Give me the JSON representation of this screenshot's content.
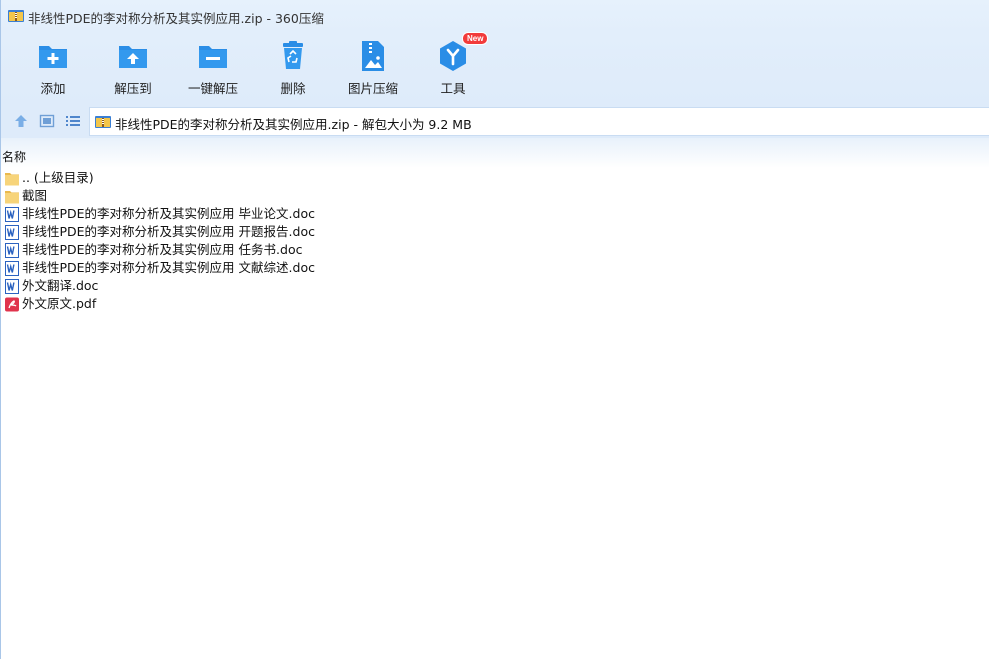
{
  "window": {
    "title": "非线性PDE的李对称分析及其实例应用.zip - 360压缩"
  },
  "toolbar": {
    "items": [
      {
        "label": "添加",
        "icon": "folder-add-icon"
      },
      {
        "label": "解压到",
        "icon": "folder-extract-icon"
      },
      {
        "label": "一键解压",
        "icon": "folder-oneclick-extract-icon"
      },
      {
        "label": "删除",
        "icon": "recycle-bin-icon"
      },
      {
        "label": "图片压缩",
        "icon": "image-compress-icon"
      },
      {
        "label": "工具",
        "icon": "tools-cube-icon",
        "badge": "New"
      }
    ]
  },
  "navbar": {
    "path_text": "非线性PDE的李对称分析及其实例应用.zip - 解包大小为 9.2 MB"
  },
  "list": {
    "column_name": "名称",
    "items": [
      {
        "name": ".. (上级目录)",
        "type": "folder"
      },
      {
        "name": "截图",
        "type": "folder"
      },
      {
        "name": "非线性PDE的李对称分析及其实例应用 毕业论文.doc",
        "type": "word"
      },
      {
        "name": "非线性PDE的李对称分析及其实例应用 开题报告.doc",
        "type": "word"
      },
      {
        "name": "非线性PDE的李对称分析及其实例应用 任务书.doc",
        "type": "word"
      },
      {
        "name": "非线性PDE的李对称分析及其实例应用 文献综述.doc",
        "type": "word"
      },
      {
        "name": "外文翻译.doc",
        "type": "word"
      },
      {
        "name": "外文原文.pdf",
        "type": "pdf"
      }
    ]
  },
  "colors": {
    "accent_blue": "#2a8de6",
    "titlebar_bg": "#e4effb",
    "badge_red": "#f23b3b",
    "pdf_red": "#e0334c",
    "folder_yellow": "#f7d47a"
  }
}
